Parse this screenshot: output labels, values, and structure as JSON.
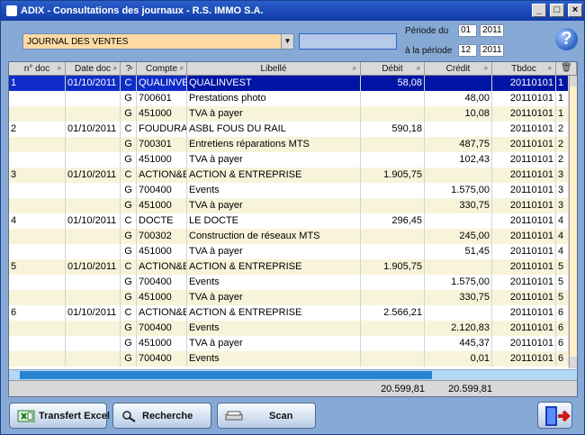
{
  "window": {
    "title": "ADIX - Consultations des journaux  -  R.S. IMMO S.A."
  },
  "controls": {
    "journal": "JOURNAL DES VENTES",
    "period_from_label": "Période du",
    "period_to_label": "à la période",
    "from_month": "01",
    "from_year": "2011",
    "to_month": "12",
    "to_year": "2011"
  },
  "table": {
    "headers": [
      "n° doc",
      "Date doc",
      "?",
      "Compte",
      "Libellé",
      "Débit",
      "Crédit",
      "Tbdoc"
    ],
    "rows": [
      {
        "doc": "1",
        "date": "01/10/2011",
        "qty": "C",
        "compte": "QUALINVE",
        "lib": "QUALINVEST",
        "debit": "58,08",
        "credit": "",
        "tb": "20110101",
        "last": "1"
      },
      {
        "doc": "",
        "date": "",
        "qty": "G",
        "compte": "700601",
        "lib": "Prestations photo",
        "debit": "",
        "credit": "48,00",
        "tb": "20110101",
        "last": "1"
      },
      {
        "doc": "",
        "date": "",
        "qty": "G",
        "compte": "451000",
        "lib": "TVA à payer",
        "debit": "",
        "credit": "10,08",
        "tb": "20110101",
        "last": "1"
      },
      {
        "doc": "2",
        "date": "01/10/2011",
        "qty": "C",
        "compte": "FOUDURA",
        "lib": "ASBL FOUS DU RAIL",
        "debit": "590,18",
        "credit": "",
        "tb": "20110101",
        "last": "2"
      },
      {
        "doc": "",
        "date": "",
        "qty": "G",
        "compte": "700301",
        "lib": "Entretiens réparations MTS",
        "debit": "",
        "credit": "487,75",
        "tb": "20110101",
        "last": "2"
      },
      {
        "doc": "",
        "date": "",
        "qty": "G",
        "compte": "451000",
        "lib": "TVA à payer",
        "debit": "",
        "credit": "102,43",
        "tb": "20110101",
        "last": "2"
      },
      {
        "doc": "3",
        "date": "01/10/2011",
        "qty": "C",
        "compte": "ACTION&E",
        "lib": "ACTION & ENTREPRISE",
        "debit": "1.905,75",
        "credit": "",
        "tb": "20110101",
        "last": "3"
      },
      {
        "doc": "",
        "date": "",
        "qty": "G",
        "compte": "700400",
        "lib": "Events",
        "debit": "",
        "credit": "1.575,00",
        "tb": "20110101",
        "last": "3"
      },
      {
        "doc": "",
        "date": "",
        "qty": "G",
        "compte": "451000",
        "lib": "TVA à payer",
        "debit": "",
        "credit": "330,75",
        "tb": "20110101",
        "last": "3"
      },
      {
        "doc": "4",
        "date": "01/10/2011",
        "qty": "C",
        "compte": "DOCTE",
        "lib": "LE DOCTE",
        "debit": "296,45",
        "credit": "",
        "tb": "20110101",
        "last": "4"
      },
      {
        "doc": "",
        "date": "",
        "qty": "G",
        "compte": "700302",
        "lib": "Construction de réseaux MTS",
        "debit": "",
        "credit": "245,00",
        "tb": "20110101",
        "last": "4"
      },
      {
        "doc": "",
        "date": "",
        "qty": "G",
        "compte": "451000",
        "lib": "TVA à payer",
        "debit": "",
        "credit": "51,45",
        "tb": "20110101",
        "last": "4"
      },
      {
        "doc": "5",
        "date": "01/10/2011",
        "qty": "C",
        "compte": "ACTION&E",
        "lib": "ACTION & ENTREPRISE",
        "debit": "1.905,75",
        "credit": "",
        "tb": "20110101",
        "last": "5"
      },
      {
        "doc": "",
        "date": "",
        "qty": "G",
        "compte": "700400",
        "lib": "Events",
        "debit": "",
        "credit": "1.575,00",
        "tb": "20110101",
        "last": "5"
      },
      {
        "doc": "",
        "date": "",
        "qty": "G",
        "compte": "451000",
        "lib": "TVA à payer",
        "debit": "",
        "credit": "330,75",
        "tb": "20110101",
        "last": "5"
      },
      {
        "doc": "6",
        "date": "01/10/2011",
        "qty": "C",
        "compte": "ACTION&E",
        "lib": "ACTION & ENTREPRISE",
        "debit": "2.566,21",
        "credit": "",
        "tb": "20110101",
        "last": "6"
      },
      {
        "doc": "",
        "date": "",
        "qty": "G",
        "compte": "700400",
        "lib": "Events",
        "debit": "",
        "credit": "2.120,83",
        "tb": "20110101",
        "last": "6"
      },
      {
        "doc": "",
        "date": "",
        "qty": "G",
        "compte": "451000",
        "lib": "TVA à payer",
        "debit": "",
        "credit": "445,37",
        "tb": "20110101",
        "last": "6"
      },
      {
        "doc": "",
        "date": "",
        "qty": "G",
        "compte": "700400",
        "lib": "Events",
        "debit": "",
        "credit": "0,01",
        "tb": "20110101",
        "last": "6"
      }
    ],
    "total_debit": "20.599,81",
    "total_credit": "20.599,81"
  },
  "buttons": {
    "transfer": "Transfert Excel",
    "search": "Recherche",
    "scan": "Scan"
  },
  "icons": {
    "help": "help-icon",
    "excel": "excel-icon",
    "search": "search-icon",
    "scan": "scanner-icon",
    "exit": "exit-icon"
  }
}
